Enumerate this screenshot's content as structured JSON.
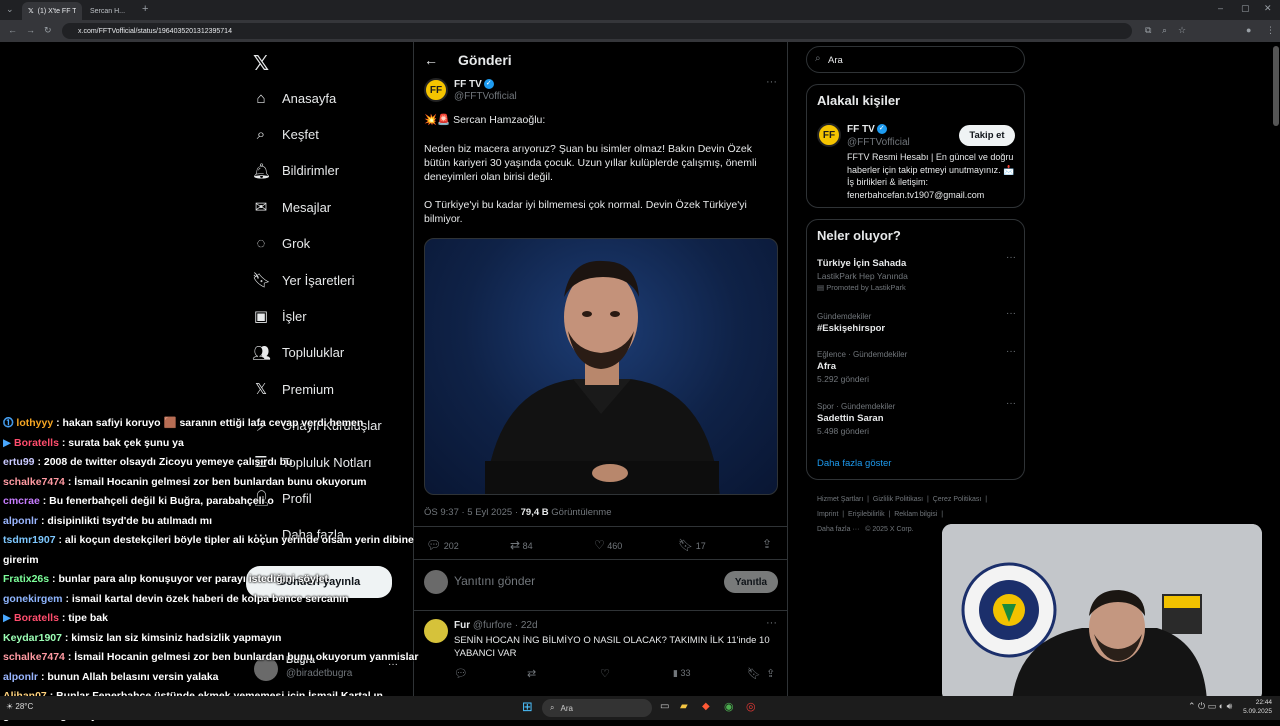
{
  "browser": {
    "tabs": [
      {
        "label": "(1) X'te FF TV: \"💥🚨",
        "active": true
      },
      {
        "label": "Sercan H...",
        "active": false
      }
    ],
    "url": "x.com/FFTVofficial/status/1964035201312395714"
  },
  "sidebar": {
    "items": [
      {
        "label": "Anasayfa",
        "icon": "home-icon"
      },
      {
        "label": "Keşfet",
        "icon": "search-icon"
      },
      {
        "label": "Bildirimler",
        "icon": "bell-icon"
      },
      {
        "label": "Mesajlar",
        "icon": "mail-icon"
      },
      {
        "label": "Grok",
        "icon": "grok-icon"
      },
      {
        "label": "Yer İşaretleri",
        "icon": "bookmark-icon"
      },
      {
        "label": "İşler",
        "icon": "briefcase-icon"
      },
      {
        "label": "Topluluklar",
        "icon": "people-icon"
      },
      {
        "label": "Premium",
        "icon": "x-logo-icon"
      },
      {
        "label": "Onaylı Kuruluşlar",
        "icon": "lightning-icon"
      },
      {
        "label": "Topluluk Notları",
        "icon": "notes-icon"
      },
      {
        "label": "Profil",
        "icon": "user-icon"
      },
      {
        "label": "Daha fazla",
        "icon": "more-icon"
      }
    ],
    "post_button": "Gönderi yayınla",
    "account": {
      "name": "Buğra",
      "handle": "@biradetbugra"
    }
  },
  "main": {
    "header": "Gönderi",
    "post": {
      "author": "FF TV",
      "handle": "@FFTVofficial",
      "line1": "💥🚨 Sercan Hamzaoğlu:",
      "para1": "Neden biz macera arıyoruz? Şuan bu isimler olmaz! Bakın Devin Özek bütün kariyeri 30 yaşında çocuk. Uzun yıllar kulüplerde çalışmış, önemli deneyimleri olan birisi değil.",
      "para2": "O Türkiye'yi bu kadar iyi bilmemesi çok normal. Devin Özek Türkiye'yi bilmiyor.",
      "time": "ÖS 9:37 · 5 Eyl 2025 · ",
      "views": "79,4 B",
      "views_label": "Görüntülenme",
      "stats": {
        "replies": "202",
        "reposts": "84",
        "likes": "460",
        "bookmarks": "17"
      }
    },
    "reply_box": {
      "placeholder": "Yanıtını gönder",
      "button": "Yanıtla"
    },
    "reply": {
      "author": "Fur",
      "handle": "@furfore · 22d",
      "text": "SENİN HOCAN İNG BİLMİYO O NASIL OLACAK? TAKIMIN İLK 11'inde 10 YABANCI VAR",
      "views": "33"
    }
  },
  "right": {
    "search_placeholder": "Ara",
    "related": {
      "title": "Alakalı kişiler",
      "name": "FF TV",
      "handle": "@FFTVofficial",
      "follow": "Takip et",
      "bio": "FFTV Resmi Hesabı | En güncel ve doğru haberler için takip etmeyi unutmayınız. 📩 İş birlikleri & iletişim: fenerbahcefan.tv1907@gmail.com"
    },
    "trends": {
      "title": "Neler oluyor?",
      "items": [
        {
          "context": "",
          "name": "Türkiye İçin Sahada",
          "sub": "LastikPark Hep Yanında",
          "extra": "Promoted by LastikPark"
        },
        {
          "context": "Gündemdekiler",
          "name": "#Eskişehirspor",
          "sub": "",
          "extra": ""
        },
        {
          "context": "Eğlence · Gündemdekiler",
          "name": "Afra",
          "sub": "5.292 gönderi",
          "extra": ""
        },
        {
          "context": "Spor · Gündemdekiler",
          "name": "Sadettin Saran",
          "sub": "5.498 gönderi",
          "extra": ""
        }
      ],
      "more": "Daha fazla göster"
    },
    "footer": [
      "Hizmet Şartları",
      "Gizlilik Politikası",
      "Çerez Politikası",
      "Imprint",
      "Erişilebilirlik",
      "Reklam bilgisi",
      "Daha fazla ···",
      "© 2025 X Corp."
    ]
  },
  "chat": [
    {
      "user": "lothyyy",
      "color": "#f5a623",
      "badge": "⓵",
      "msg": ": hakan safiyi koruyo 🟫 saranın ettiği lafa cevap verdi hemen"
    },
    {
      "user": "Boratells",
      "color": "#ff4d6d",
      "badge": "▶",
      "msg": ": surata bak çek şunu ya"
    },
    {
      "user": "ertu99",
      "color": "#c9c9ff",
      "badge": "",
      "msg": ": 2008 de twitter olsaydı Zicoyu yemeye çalışırdı bu"
    },
    {
      "user": "schalke7474",
      "color": "#ff9aa2",
      "badge": "",
      "msg": ": İsmail Hocanin gelmesi zor ben bunlardan bunu okuyorum"
    },
    {
      "user": "cmcrae",
      "color": "#c77dff",
      "badge": "",
      "msg": ": Bu fenerbahçeli değil ki Buğra, parabahçeli o"
    },
    {
      "user": "alponlr",
      "color": "#9ab6ff",
      "badge": "",
      "msg": ": disipinlikti tsyd'de bu atılmadı mı"
    },
    {
      "user": "tsdmr1907",
      "color": "#7ec8ff",
      "badge": "",
      "msg": ": ali koçun destekçileri böyle tipler ali koçun yerinde olsam yerin dibine"
    },
    {
      "user": "",
      "color": "#fff",
      "badge": "",
      "msg": "girerim"
    },
    {
      "user": "Fratix26s",
      "color": "#7dff9a",
      "badge": "",
      "msg": ": bunlar para alıp konuşuyor ver parayı istediğini söylet"
    },
    {
      "user": "gonekirgem",
      "color": "#8fb6ff",
      "badge": "",
      "msg": ": ismail kartal devin özek haberi de kolpa bence sercanın"
    },
    {
      "user": "Boratells",
      "color": "#ff4d6d",
      "badge": "▶",
      "msg": ": tipe bak"
    },
    {
      "user": "Keydar1907",
      "color": "#9cffb5",
      "badge": "",
      "msg": ": kimsiz lan siz kimsiniz hadsizlik yapmayın"
    },
    {
      "user": "schalke7474",
      "color": "#ff9aa2",
      "badge": "",
      "msg": ": İsmail Hocanin gelmesi zor ben bunlardan bunu okuyorum yanmislar"
    },
    {
      "user": "alponlr",
      "color": "#9ab6ff",
      "badge": "",
      "msg": ": bunun Allah belasını versin yalaka"
    },
    {
      "user": "Alihan07",
      "color": "#ffd27d",
      "badge": "",
      "msg": ": Bunlar Fenerbahçe üstünde ekmek yememesi için İsmail Kartal ın"
    },
    {
      "user": "",
      "color": "#fff",
      "badge": "",
      "msg": "gelmemesi gerekiyor"
    }
  ],
  "taskbar": {
    "search": "Ara",
    "weather": "28°C",
    "time": "22:44",
    "date": "5.09.2025"
  }
}
